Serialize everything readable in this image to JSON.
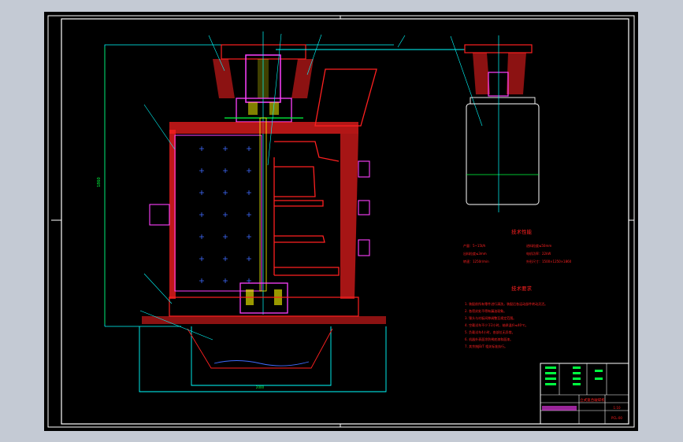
{
  "viewport": {
    "background": "#c4cad4",
    "canvas_color": "#000000"
  },
  "colors": {
    "border": "#ffffff",
    "red": "#ff2020",
    "magenta": "#ff40ff",
    "yellow": "#ffff00",
    "cyan": "#00ffff",
    "green": "#00ff40",
    "white": "#ffffff"
  },
  "drawing": {
    "tech_params_title": "技术性能",
    "tech_requirements_title": "技术要求",
    "dimension_height": "1860",
    "dimension_base": "2000",
    "tech_params": [
      "产量：5~15t/h",
      "进料粒度≤50mm",
      "出料粒度≤3mm",
      "电机功率：22kW",
      "转速：1250r/min",
      "外形尺寸：1500×1250×1860"
    ],
    "tech_requirements": [
      "1. 装配前所有零件进行清洗，装配后各运动部件转动灵活。",
      "2. 各密封处不得有漏油现象。",
      "3. 锤头与衬板间隙调整至规定范围。",
      "4. 空载试车不少于2小时，轴承温升≤40℃。",
      "5. 负载试车4小时，各部位无异常。",
      "6. 机器外表面涂防锈底漆和面漆。",
      "7. 其余按JB/T 相关标准执行。"
    ],
    "title_block": {
      "name": "立式复合破碎机",
      "drawing_no": "PCL-00",
      "scale": "1:10"
    }
  }
}
